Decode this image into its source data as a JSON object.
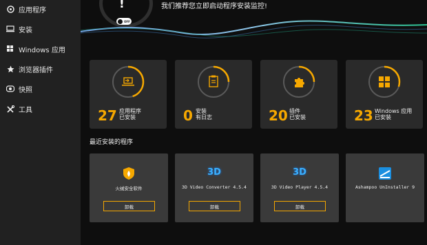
{
  "sidebar": {
    "items": [
      {
        "label": "应用程序",
        "icon": "apps-icon"
      },
      {
        "label": "安装",
        "icon": "install-icon"
      },
      {
        "label": "Windows 应用",
        "icon": "windows-apps-icon"
      },
      {
        "label": "浏览器插件",
        "icon": "browser-plugin-icon"
      },
      {
        "label": "快照",
        "icon": "snapshot-icon"
      },
      {
        "label": "工具",
        "icon": "tools-icon"
      }
    ]
  },
  "monitor": {
    "headline": "我们推荐您立即启动程序安装监控!",
    "toggle_label": "OFF",
    "alert_glyph": "!"
  },
  "stats": [
    {
      "value": "27",
      "label": "应用程序\n已安装",
      "icon": "laptop-install-icon",
      "fill": 0.45
    },
    {
      "value": "0",
      "label": "安装\n有日志",
      "icon": "clipboard-log-icon",
      "fill": 0.25
    },
    {
      "value": "20",
      "label": "插件\n已安装",
      "icon": "puzzle-icon",
      "fill": 0.25
    },
    {
      "value": "23",
      "label": "Windows 应用\n已安装",
      "icon": "windows-tiles-icon",
      "fill": 0.3
    }
  ],
  "recent": {
    "title": "最近安装的程序",
    "apps": [
      {
        "name": "火绒安全软件",
        "button": "卸载",
        "icon": "huorong-shield-icon"
      },
      {
        "name": "3D Video Converter 4.5.4",
        "button": "卸载",
        "icon": "3d-converter-icon",
        "badge": "3D"
      },
      {
        "name": "3D Video Player 4.5.4",
        "button": "卸载",
        "icon": "3d-player-icon",
        "badge": "3D"
      },
      {
        "name": "Ashampoo UnInstaller 9",
        "button": "",
        "icon": "ashampoo-uninstaller-icon"
      }
    ]
  },
  "colors": {
    "accent": "#f6a800",
    "sidebar_bg": "#212121",
    "card_bg": "#2a2a2a",
    "app_card_bg": "#3a3a3a"
  }
}
